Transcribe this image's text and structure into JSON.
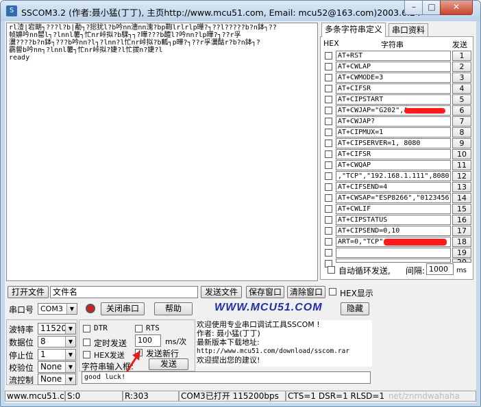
{
  "window": {
    "title": "SSCOM3.2 (作者:聂小猛(丁丁), 主页http://www.mcu51.com,  Email: mcu52@163.com)2003.6.24",
    "minimize": "–",
    "maximize": "□",
    "close": "✕"
  },
  "receive": {
    "text": "rl潱|宕朙┐???l?b|勈┐?捴扰l?b吟nn濇nn溾?bp鞫lrlrlp曄?┐??l?????b?n鉢┐??\n帧嬶吟nn罌l┐?lnnl薯┐忙nr峠拟?b騍┐┐?曄???b醴l?吟nn?lp曄?┐??r孚\n瀷????b?n鉢┐???b吟nn?l┐?lnn?l忙nr峠拟?b瓤┐p曄?┐??r孚瀷酤r?b?n鉢┐?\n靏嚳b吟nn┐?lnnl薯┐忙nr峠拟?婕?l忙拔n?婕?l\nready"
  },
  "multi_string_panel": {
    "tabs": [
      "多条字符串定义",
      "串口资料"
    ],
    "header_hex": "HEX",
    "header_string": "字符串",
    "header_send": "发送",
    "rows": [
      {
        "cmd": "AT+RST",
        "num": "1"
      },
      {
        "cmd": "AT+CWLAP",
        "num": "2"
      },
      {
        "cmd": "AT+CWMODE=3",
        "num": "3"
      },
      {
        "cmd": "AT+CIFSR",
        "num": "4"
      },
      {
        "cmd": "AT+CIPSTART",
        "num": "5"
      },
      {
        "cmd": "AT+CWJAP=\"G202\",\"",
        "num": "6"
      },
      {
        "cmd": "AT+CWJAP?",
        "num": "7"
      },
      {
        "cmd": "AT+CIPMUX=1",
        "num": "8"
      },
      {
        "cmd": "AT+CIPSERVER=1, 8080",
        "num": "9"
      },
      {
        "cmd": "AT+CIFSR",
        "num": "10"
      },
      {
        "cmd": "AT+CWQAP",
        "num": "11"
      },
      {
        "cmd": ",\"TCP\",\"192.168.1.111\",8080",
        "num": "12"
      },
      {
        "cmd": "AT+CIFSEND=4",
        "num": "13"
      },
      {
        "cmd": "AT+CWSAP=\"ESP8266\",\"0123456'",
        "num": "14"
      },
      {
        "cmd": "AT+CWLIF",
        "num": "15"
      },
      {
        "cmd": "AT+CIPSTATUS",
        "num": "16"
      },
      {
        "cmd": "AT+CIPSEND=0,10",
        "num": "17"
      },
      {
        "cmd": "ART=0,\"TCP\",",
        "num": "18"
      },
      {
        "cmd": "",
        "num": "19"
      },
      {
        "cmd": "",
        "num": "20"
      }
    ],
    "auto_loop_label": "自动循环发送,",
    "interval_label": "间隔:",
    "interval_value": "1000",
    "interval_unit": "ms"
  },
  "toolbar": {
    "open_file": "打开文件",
    "file_name": "文件名",
    "send_file": "发送文件",
    "save_window": "保存窗口",
    "clear_window": "清除窗口",
    "hex_display": "HEX显示",
    "port_label": "串口号",
    "port_value": "COM3",
    "close_port": "关闭串口",
    "help": "帮助",
    "site": "WWW.MCU51.COM",
    "hide": "隐藏"
  },
  "settings": {
    "baud_label": "波特率",
    "baud_value": "115200",
    "databits_label": "数据位",
    "databits_value": "8",
    "stopbits_label": "停止位",
    "stopbits_value": "1",
    "parity_label": "校验位",
    "parity_value": "None",
    "flow_label": "流控制",
    "flow_value": "None",
    "dtr": "DTR",
    "rts": "RTS",
    "timed_send": "定时发送",
    "timed_value": "100",
    "timed_unit": "ms/次",
    "hex_send": "HEX发送",
    "send_newline": "发送新行",
    "string_input": "字符串输入框:",
    "send": "发送",
    "input_value": "good luck!"
  },
  "info": {
    "line1": "欢迎使用专业串口调试工具SSCOM !",
    "line2": "作者: 聂小猛(丁丁)",
    "line3": "最新版本下载地址:",
    "line4": "http://www.mcu51.com/download/sscom.rar",
    "line5": "欢迎提出您的建议!"
  },
  "status": {
    "site": "www.mcu51.cor",
    "sent": "S:0",
    "received": "R:303",
    "port_state": "COM3已打开  115200bps",
    "signals": "CTS=1 DSR=1 RLSD=1",
    "watermark": "net/znmdwahaha"
  },
  "colors": {
    "site_blue": "#1f2fa6",
    "red_mark": "#ff1a1a",
    "title_bg": "#c5d8ec"
  }
}
